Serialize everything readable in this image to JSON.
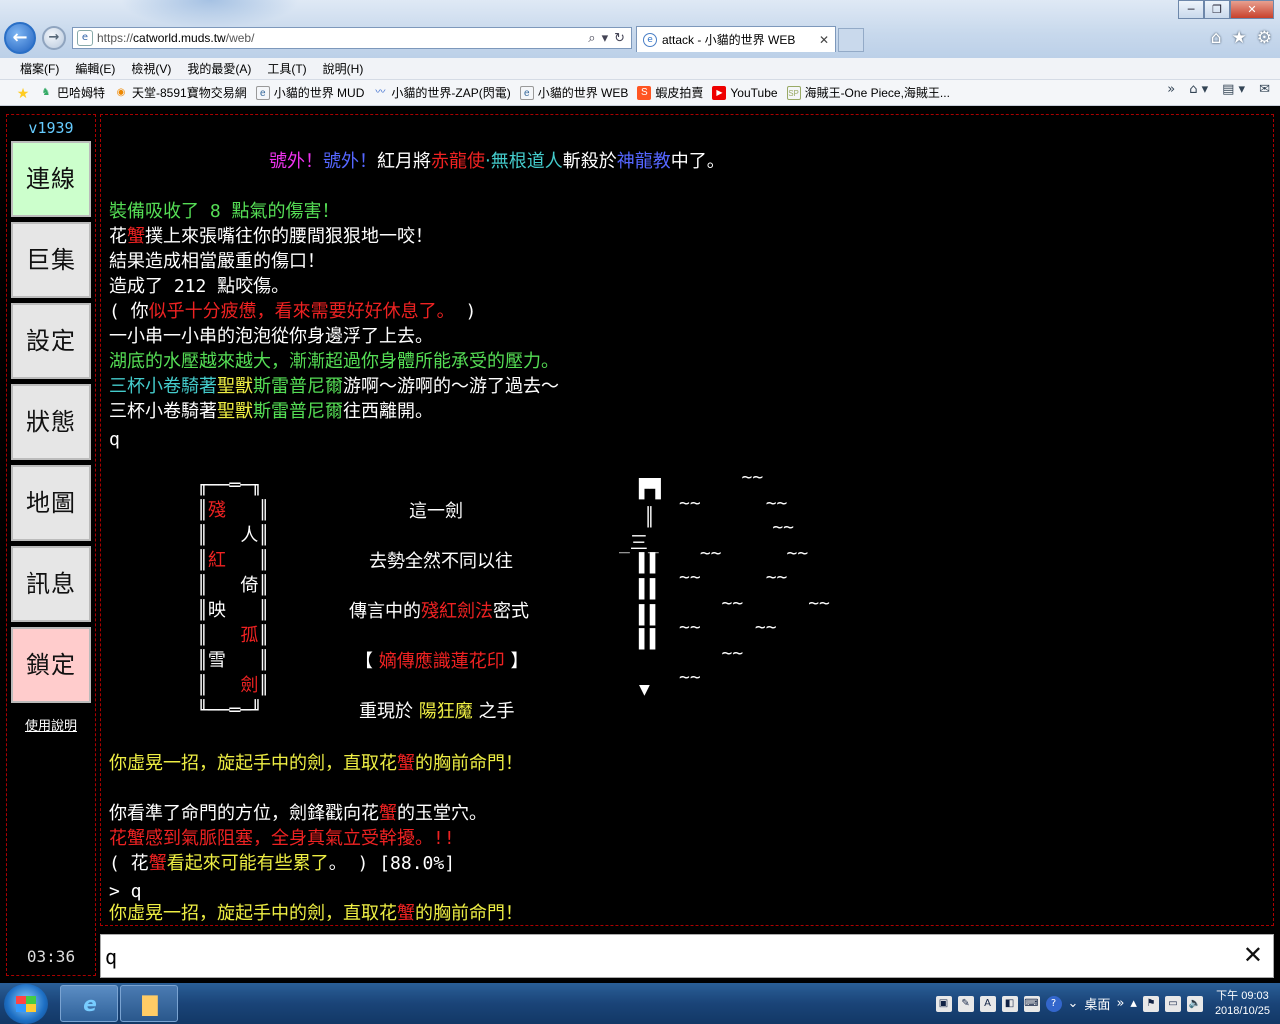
{
  "browser": {
    "url_dim": "https://",
    "url_host": "catworld.muds.tw",
    "url_path": "/web/",
    "tab_title": "attack - 小貓的世界 WEB",
    "menu": [
      "檔案(F)",
      "編輯(E)",
      "檢視(V)",
      "我的最愛(A)",
      "工具(T)",
      "說明(H)"
    ],
    "favorites": [
      {
        "label": "巴哈姆特",
        "icon": "dragon-icon",
        "color": "#3a6"
      },
      {
        "label": "天堂-8591寶物交易網",
        "icon": "coin-icon",
        "color": "#e80"
      },
      {
        "label": "小貓的世界 MUD",
        "icon": "page-icon",
        "color": "#369"
      },
      {
        "label": "小貓的世界-ZAP(閃電)",
        "icon": "zap-icon",
        "color": "#36c"
      },
      {
        "label": "小貓的世界 WEB",
        "icon": "page-icon",
        "color": "#369"
      },
      {
        "label": "蝦皮拍賣",
        "icon": "shopee-icon",
        "color": "#f52"
      },
      {
        "label": "YouTube",
        "icon": "youtube-icon",
        "color": "#e00"
      },
      {
        "label": "海賊王-One Piece,海賊王...",
        "icon": "sp-icon",
        "color": "#9a6"
      }
    ]
  },
  "sidebar": {
    "version": "v1939",
    "buttons": [
      "連線",
      "巨集",
      "設定",
      "狀態",
      "地圖",
      "訊息",
      "鎖定"
    ],
    "help": "使用說明",
    "clock": "03:36"
  },
  "output": {
    "l1": [
      [
        "c-m",
        "號外！"
      ],
      [
        "c-b",
        "號外！"
      ],
      [
        "c-W",
        "紅月將"
      ],
      [
        "c-r",
        "赤龍使"
      ],
      [
        "c-c",
        "‧無根道人"
      ],
      [
        "c-W",
        "斬殺於"
      ],
      [
        "c-b",
        "神龍教"
      ],
      [
        "c-W",
        "中了。"
      ]
    ],
    "l2": [
      [
        "c-g",
        "裝備吸收了 8 點氣的傷害！"
      ]
    ],
    "l3": [
      [
        "c-W",
        "花"
      ],
      [
        "c-r",
        "蟹"
      ],
      [
        "c-W",
        "撲上來張嘴往你的腰間狠狠地一咬！"
      ]
    ],
    "l4": [
      [
        "c-W",
        "結果造成相當嚴重的傷口！"
      ]
    ],
    "l5": [
      [
        "c-W",
        "造成了 212 點咬傷。"
      ]
    ],
    "l6": [
      [
        "c-W",
        "( 你"
      ],
      [
        "c-r",
        "似乎十分疲憊，看來需要好好休息了。"
      ],
      [
        "c-W",
        " )"
      ]
    ],
    "l7": [
      [
        "c-W",
        "一小串一小串的泡泡從你身邊浮了上去。"
      ]
    ],
    "l8": [
      [
        "c-g",
        "湖底的水壓越來越大，漸漸超過你身體所能承受的壓力。"
      ]
    ],
    "l9": [
      [
        "c-c",
        "三杯小卷騎著"
      ],
      [
        "c-y",
        "聖獸"
      ],
      [
        "c-g",
        "斯雷普尼爾"
      ],
      [
        "c-W",
        "游啊～游啊的～游了過去～"
      ]
    ],
    "l10": [
      [
        "c-W",
        "三杯小卷騎著"
      ],
      [
        "c-y",
        "聖獸"
      ],
      [
        "c-g",
        "斯雷普尼爾"
      ],
      [
        "c-W",
        "往西離開。"
      ]
    ],
    "l11": [
      [
        "c-W",
        "q"
      ]
    ],
    "art_box": [
      [
        [
          "c-W",
          "╓──═─╖"
        ]
      ],
      [
        [
          "c-W",
          "║"
        ],
        [
          "c-r",
          "殘"
        ],
        [
          "c-W",
          "   ║"
        ]
      ],
      [
        [
          "c-W",
          "║   人║"
        ]
      ],
      [
        [
          "c-W",
          "║"
        ],
        [
          "c-r",
          "紅"
        ],
        [
          "c-W",
          "   ║"
        ]
      ],
      [
        [
          "c-W",
          "║   倚║"
        ]
      ],
      [
        [
          "c-W",
          "║映   ║"
        ]
      ],
      [
        [
          "c-W",
          "║   "
        ],
        [
          "c-r",
          "孤"
        ],
        [
          "c-W",
          "║"
        ]
      ],
      [
        [
          "c-W",
          "║雪   ║"
        ]
      ],
      [
        [
          "c-W",
          "║   "
        ],
        [
          "c-r",
          "劍"
        ],
        [
          "c-W",
          "║"
        ]
      ],
      [
        [
          "c-W",
          "╙──═─╜"
        ]
      ]
    ],
    "poem": [
      [
        [
          "c-W",
          "這一劍"
        ]
      ],
      [
        [
          "c-W",
          "去勢全然不同以往"
        ]
      ],
      [
        [
          "c-W",
          "傳言中的"
        ],
        [
          "c-r",
          "殘紅劍法"
        ],
        [
          "c-W",
          "密式"
        ]
      ],
      [
        [
          "c-W",
          "【 "
        ],
        [
          "c-r",
          "嫡傳應識蓮花印"
        ],
        [
          "c-W",
          " 】"
        ]
      ],
      [
        [
          "c-W",
          "重現於 "
        ],
        [
          "c-y",
          "陽狂魔"
        ],
        [
          "c-W",
          " 之手"
        ]
      ]
    ],
    "sword": [
      [
        [
          "c-W",
          "   ~~"
        ]
      ],
      [
        [
          "c-W",
          "▛▜"
        ]
      ],
      [
        [
          "c-W",
          "~~      ~~"
        ]
      ],
      [
        [
          "c-W",
          "║"
        ]
      ],
      [
        [
          "c-W",
          "    ~~"
        ]
      ],
      [
        [
          "c-W",
          "_三_"
        ]
      ],
      [
        [
          "c-W",
          " ~~      ~~"
        ]
      ],
      [
        [
          "c-W",
          "▌▌"
        ]
      ],
      [
        [
          "c-W",
          "~~      ~~"
        ]
      ],
      [
        [
          "c-W",
          "▌▌"
        ]
      ],
      [
        [
          "c-W",
          "   ~~      ~~"
        ]
      ],
      [
        [
          "c-W",
          "▌▌"
        ]
      ],
      [
        [
          "c-W",
          "~~     ~~"
        ]
      ],
      [
        [
          "c-W",
          "▌▌"
        ]
      ],
      [
        [
          "c-W",
          "   ~~"
        ]
      ],
      [
        [
          "c-W",
          "▼"
        ]
      ],
      [
        [
          "c-W",
          "~~"
        ]
      ]
    ],
    "l12": [
      [
        "c-y",
        "你虛晃一招，旋起手中的劍，直取花"
      ],
      [
        "c-r",
        "蟹"
      ],
      [
        "c-y",
        "的胸前命門！"
      ]
    ],
    "l13": [
      [
        "c-W",
        "你看準了命門的方位，劍鋒戳向花"
      ],
      [
        "c-r",
        "蟹"
      ],
      [
        "c-W",
        "的玉堂穴。"
      ]
    ],
    "l14": [
      [
        "c-r",
        "花蟹感到氣脈阻塞，全身真氣立受幹擾。!!"
      ]
    ],
    "l15": [
      [
        "c-W",
        "( 花"
      ],
      [
        "c-r",
        "蟹"
      ],
      [
        "c-y",
        "看起來可能有些累了"
      ],
      [
        "c-W",
        "。 ) [88.0%]"
      ]
    ],
    "l16": [
      [
        "c-W",
        "> q"
      ]
    ],
    "l17": [
      [
        "c-y",
        "你虛晃一招，旋起手中的劍，直取花"
      ],
      [
        "c-r",
        "蟹"
      ],
      [
        "c-y",
        "的胸前命門！"
      ]
    ]
  },
  "input": {
    "value": "q"
  },
  "taskbar": {
    "tray_text": "桌面",
    "time": "下午 09:03",
    "date": "2018/10/25"
  }
}
